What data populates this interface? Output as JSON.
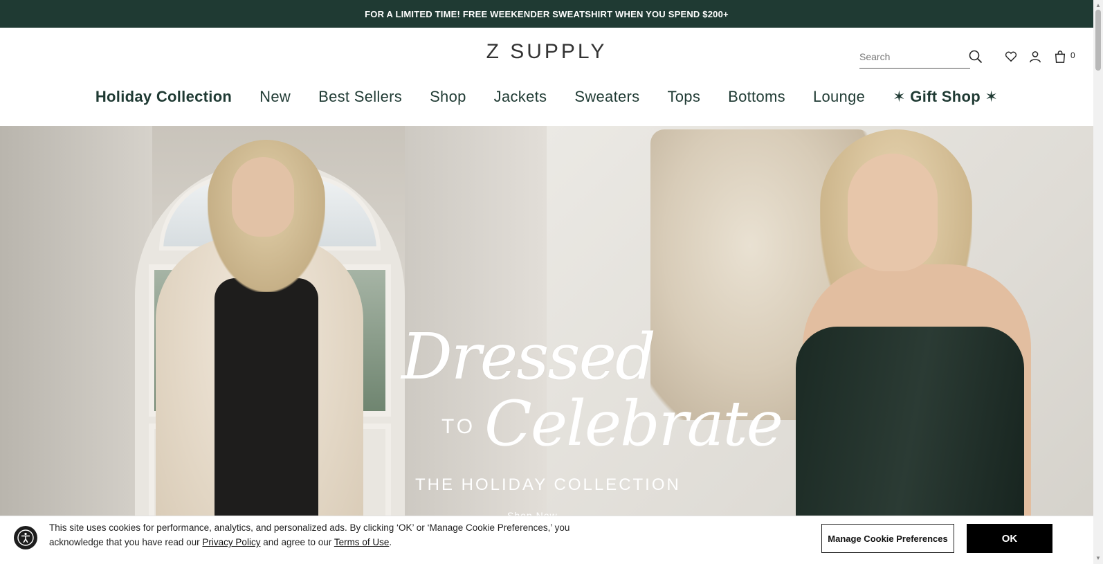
{
  "announcement": "FOR A LIMITED TIME! FREE WEEKENDER SWEATSHIRT WHEN YOU SPEND $200+",
  "header": {
    "logo": "Z SUPPLY",
    "search_placeholder": "Search",
    "cart_count": "0",
    "icons": [
      "search-icon",
      "heart-icon",
      "account-icon",
      "cart-icon"
    ]
  },
  "nav": {
    "items": [
      {
        "label": "Holiday Collection"
      },
      {
        "label": "New"
      },
      {
        "label": "Best Sellers"
      },
      {
        "label": "Shop"
      },
      {
        "label": "Jackets"
      },
      {
        "label": "Sweaters"
      },
      {
        "label": "Tops"
      },
      {
        "label": "Bottoms"
      },
      {
        "label": "Lounge"
      },
      {
        "label": "✶ Gift Shop ✶"
      }
    ]
  },
  "hero": {
    "script_line1": "Dressed",
    "to": "TO",
    "script_line2": "Celebrate",
    "subtitle": "THE HOLIDAY COLLECTION",
    "cta": "Shop Now"
  },
  "cookie": {
    "text_before": "This site uses cookies for performance, analytics, and personalized ads. By clicking ‘OK’ or ‘Manage Cookie Preferences,’ you acknowledge that you have read our",
    "privacy_link": "Privacy Policy",
    "text_middle": "and agree to our",
    "terms_link": "Terms of Use",
    "text_end": ".",
    "prefs_button": "Manage Cookie Preferences",
    "ok_button": "OK"
  },
  "colors": {
    "announcement_bg": "#1f3a33",
    "nav_text": "#1f3a33",
    "ok_button_bg": "#000000"
  }
}
